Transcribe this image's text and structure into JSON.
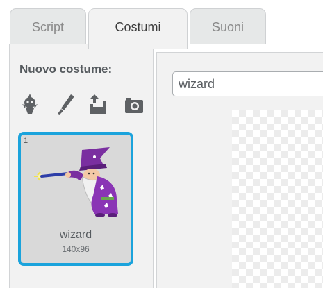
{
  "tabs": {
    "script": "Script",
    "costumes": "Costumi",
    "sounds": "Suoni"
  },
  "costume_panel": {
    "new_costume_label": "Nuovo costume:",
    "tools": [
      {
        "icon": "character-library-icon"
      },
      {
        "icon": "paintbrush-icon"
      },
      {
        "icon": "upload-icon"
      },
      {
        "icon": "camera-icon"
      }
    ],
    "costumes": [
      {
        "index": "1",
        "name": "wizard",
        "size": "140x96",
        "selected": true
      }
    ]
  },
  "editor": {
    "costume_name_value": "wizard"
  },
  "colors": {
    "selected_border": "#1ba3dc",
    "icon_color": "#5e6164",
    "panel_bg": "#f2f2f2"
  }
}
